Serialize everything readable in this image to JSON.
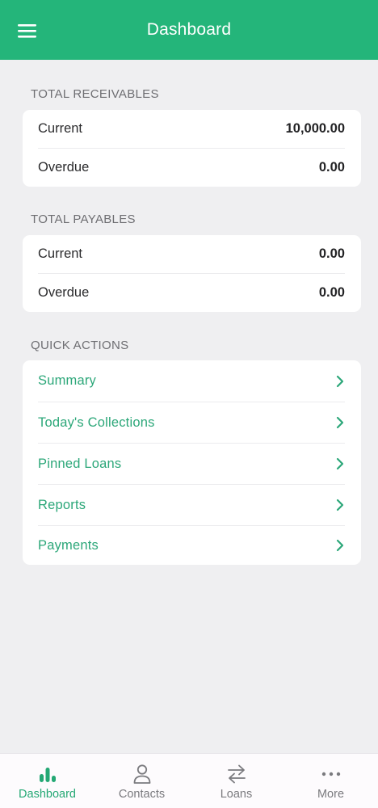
{
  "header": {
    "title": "Dashboard",
    "menu_icon": "hamburger-menu-icon",
    "background": "#24b57a"
  },
  "receivables": {
    "label": "TOTAL RECEIVABLES",
    "rows": [
      {
        "label": "Current",
        "value": "10,000.00"
      },
      {
        "label": "Overdue",
        "value": "0.00"
      }
    ]
  },
  "payables": {
    "label": "TOTAL PAYABLES",
    "rows": [
      {
        "label": "Current",
        "value": "0.00"
      },
      {
        "label": "Overdue",
        "value": "0.00"
      }
    ]
  },
  "quick_actions": {
    "label": "QUICK ACTIONS",
    "items": [
      {
        "label": "Summary",
        "icon": "chevron-right-icon"
      },
      {
        "label": "Today's Collections",
        "icon": "chevron-right-icon"
      },
      {
        "label": "Pinned Loans",
        "icon": "chevron-right-icon"
      },
      {
        "label": "Reports",
        "icon": "chevron-right-icon"
      },
      {
        "label": "Payments",
        "icon": "chevron-right-icon"
      }
    ]
  },
  "bottom_nav": {
    "items": [
      {
        "label": "Dashboard",
        "icon": "bar-chart-icon",
        "active": true
      },
      {
        "label": "Contacts",
        "icon": "person-icon",
        "active": false
      },
      {
        "label": "Loans",
        "icon": "swap-arrows-icon",
        "active": false
      },
      {
        "label": "More",
        "icon": "more-dots-icon",
        "active": false
      }
    ]
  },
  "colors": {
    "accent": "#24b57a",
    "action_text": "#2ca779",
    "background": "#efeff1",
    "inactive_nav": "#7a7a7e"
  }
}
